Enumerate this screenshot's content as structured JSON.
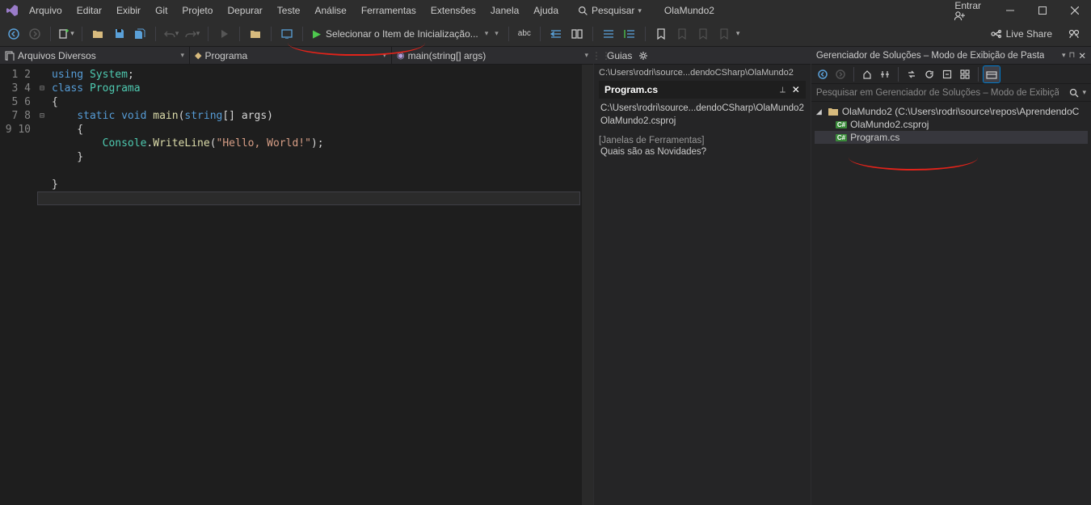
{
  "menu": [
    "Arquivo",
    "Editar",
    "Exibir",
    "Git",
    "Projeto",
    "Depurar",
    "Teste",
    "Análise",
    "Ferramentas",
    "Extensões",
    "Janela",
    "Ajuda"
  ],
  "search_label": "Pesquisar",
  "solution_name": "OlaMundo2",
  "sign_in": "Entrar",
  "run_selector": "Selecionar o Item de Inicialização...",
  "live_share": "Live Share",
  "crumbs": {
    "file": "Arquivos Diversos",
    "class": "Programa",
    "member": "main(string[] args)"
  },
  "code_lines": [
    {
      "n": 1,
      "fold": "",
      "html": "<span class=\"kw\">using</span> <span class=\"cls\">System</span>;"
    },
    {
      "n": 2,
      "fold": "⊟",
      "html": "<span class=\"kw\">class</span> <span class=\"cls\">Programa</span>"
    },
    {
      "n": 3,
      "fold": "",
      "html": "{"
    },
    {
      "n": 4,
      "fold": "⊟",
      "html": "    <span class=\"kw\">static</span> <span class=\"type\">void</span> <span class=\"fn\">main</span>(<span class=\"type\">string</span>[] <span>args</span>)"
    },
    {
      "n": 5,
      "fold": "",
      "html": "    {"
    },
    {
      "n": 6,
      "fold": "",
      "html": "        <span class=\"cls\">Console</span>.<span class=\"fn\">WriteLine</span>(<span class=\"str\">\"Hello, World!\"</span>);"
    },
    {
      "n": 7,
      "fold": "",
      "html": "    }"
    },
    {
      "n": 8,
      "fold": "",
      "html": ""
    },
    {
      "n": 9,
      "fold": "",
      "html": "}"
    },
    {
      "n": 10,
      "fold": "",
      "html": ""
    }
  ],
  "guias": {
    "title": "Guias",
    "path_top": "C:\\Users\\rodri\\source...dendoCSharp\\OlaMundo2",
    "active_tab": "Program.cs",
    "path_mid": "C:\\Users\\rodri\\source...dendoCSharp\\OlaMundo2",
    "csproj": "OlaMundo2.csproj",
    "section": "Janelas de Ferramentas",
    "whatsnew": "Quais são as Novidades?"
  },
  "sol": {
    "title": "Gerenciador de Soluções – Modo de Exibição de Pasta",
    "search_placeholder": "Pesquisar em Gerenciador de Soluções – Modo de Exibição d",
    "root": "OlaMundo2 (C:\\Users\\rodri\\source\\repos\\AprendendoC",
    "csproj": "OlaMundo2.csproj",
    "program": "Program.cs"
  }
}
